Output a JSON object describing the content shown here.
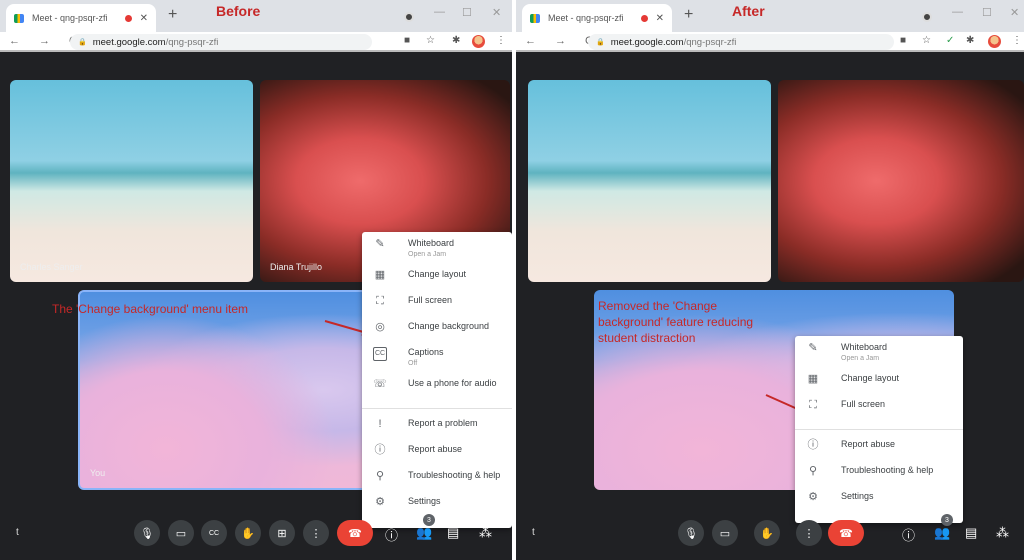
{
  "browser": {
    "tab_title": "Meet - qng-psqr-zfi",
    "new_tab": "+",
    "url_host": "meet.google.com",
    "url_path": "/qng-psqr-zfi",
    "icons": {
      "back": "←",
      "forward": "→",
      "reload": "C",
      "lock": "🔒",
      "camera": "■",
      "star": "☆",
      "extension": "✱",
      "menu": "⋮",
      "minimize": "—",
      "maximize": "☐",
      "close": "✕"
    }
  },
  "panels": {
    "before": {
      "heading": "Before",
      "participants": [
        {
          "name": "Charles Sanger"
        },
        {
          "name": "Diana Trujillo"
        },
        {
          "name": "You"
        }
      ],
      "annotation": "The 'Change background' menu item",
      "menu": {
        "group1": [
          {
            "icon": "✎",
            "label": "Whiteboard",
            "sub": "Open a Jam"
          },
          {
            "icon": "▦",
            "label": "Change layout"
          },
          {
            "icon": "⛶",
            "label": "Full screen"
          },
          {
            "icon": "◎",
            "label": "Change background"
          },
          {
            "icon": "CC",
            "label": "Captions",
            "sub": "Off"
          },
          {
            "icon": "☏",
            "label": "Use a phone for audio"
          }
        ],
        "group2": [
          {
            "icon": "!",
            "label": "Report a problem"
          },
          {
            "icon": "ⓘ",
            "label": "Report abuse"
          },
          {
            "icon": "⚲",
            "label": "Troubleshooting & help"
          },
          {
            "icon": "⚙",
            "label": "Settings"
          }
        ]
      }
    },
    "after": {
      "heading": "After",
      "annotation": "Removed the 'Change background' feature reducing student distraction",
      "menu": {
        "group1": [
          {
            "icon": "✎",
            "label": "Whiteboard",
            "sub": "Open a Jam"
          },
          {
            "icon": "▦",
            "label": "Change layout"
          },
          {
            "icon": "⛶",
            "label": "Full screen"
          }
        ],
        "group2": [
          {
            "icon": "ⓘ",
            "label": "Report abuse"
          },
          {
            "icon": "⚲",
            "label": "Troubleshooting & help"
          },
          {
            "icon": "⚙",
            "label": "Settings"
          }
        ]
      }
    }
  },
  "controls": {
    "meeting_code": "t",
    "mic": "🎙",
    "camera": "▭",
    "captions": "CC",
    "raise_hand": "✋",
    "present": "⊞",
    "more": "⋮",
    "hangup": "☎",
    "info": "ⓘ",
    "people": "👥",
    "people_count": "3",
    "chat": "▤",
    "activities": "⁂"
  },
  "colors": {
    "annotation": "#c62828",
    "hangup": "#ea4335",
    "background": "#202124"
  }
}
